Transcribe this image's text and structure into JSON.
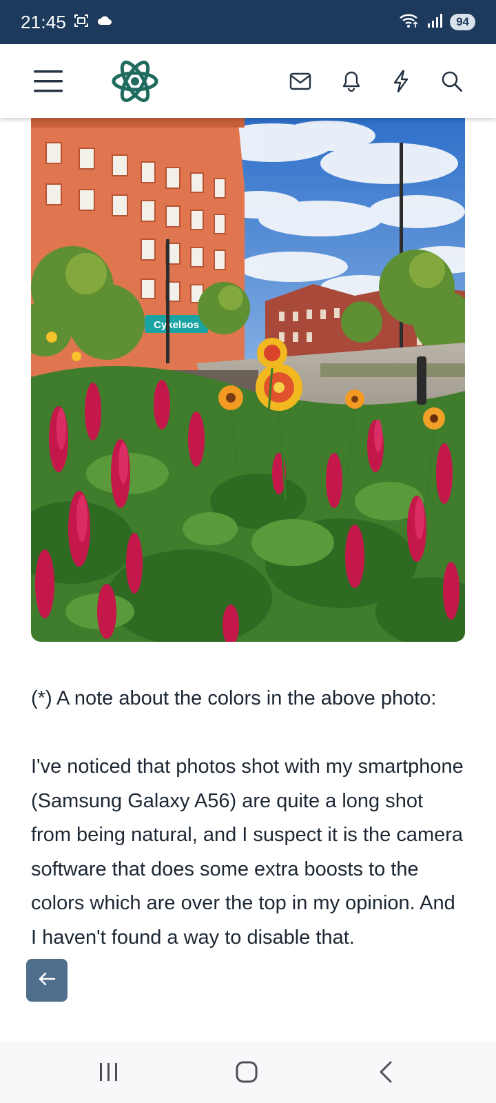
{
  "status_bar": {
    "time": "21:45",
    "battery": "94",
    "icons": [
      "screenshot-icon",
      "cloud-icon",
      "wifi-icon",
      "signal-icon",
      "battery-icon"
    ]
  },
  "header": {
    "icons": [
      "hamburger-menu-icon",
      "atom-logo-icon",
      "mail-icon",
      "bell-icon",
      "lightning-bolt-icon",
      "search-icon"
    ],
    "accent_color": "#1f6b5e"
  },
  "article": {
    "paragraph_1": "(*) A note about the colors in the above photo:",
    "paragraph_2": "I've noticed that photos shot with my smartphone (Samsung Galaxy A56) are quite a long shot from being natural, and I suspect it is the camera software that does some extra boosts to the colors which are over the top in my opinion. And I haven't found a way to disable that.",
    "storefront_sign": "Cykelsos"
  },
  "nav_bar": {
    "icons": [
      "recent-apps-icon",
      "home-icon",
      "back-icon"
    ]
  },
  "colors": {
    "status_bar_bg": "#1d3a5c",
    "text": "#1c2733",
    "fab_bg": "#2f5578"
  }
}
